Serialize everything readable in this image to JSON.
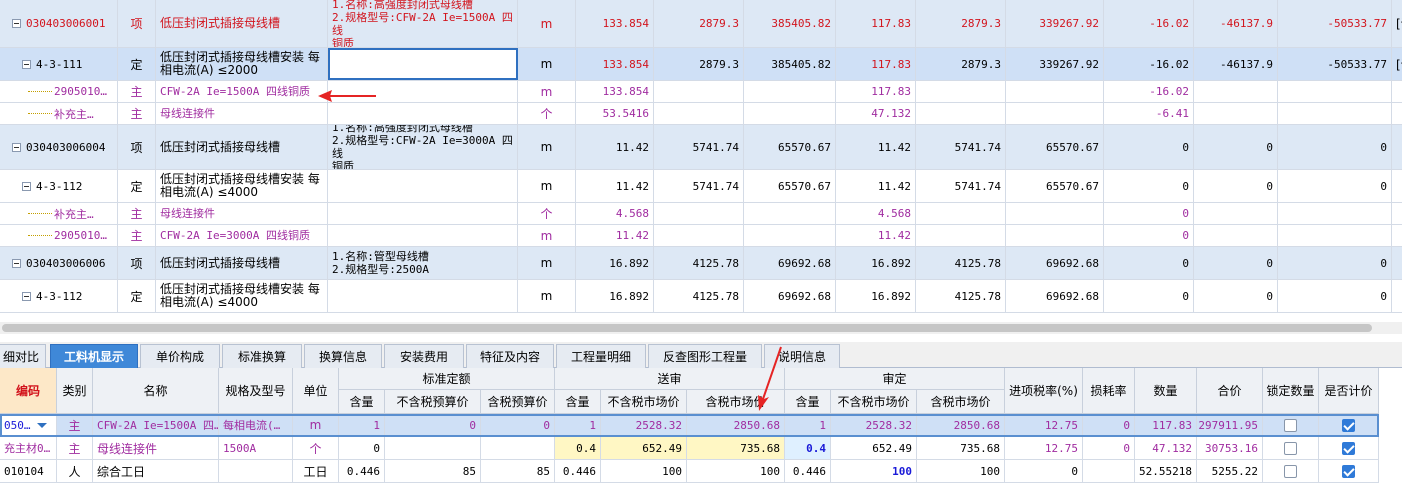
{
  "top_rows": [
    {
      "type": "qd",
      "code": "030403006001",
      "cat": "项",
      "name": "低压封闭式插接母线槽",
      "feat": [
        "1.名称:高强度封闭式母线槽",
        "2.规格型号:CFW-2A Ie=1500A 四线",
        "铜质"
      ],
      "unit": "m",
      "v": [
        "133.854",
        "2879.3",
        "385405.82",
        "117.83",
        "2879.3",
        "339267.92",
        "-16.02",
        "-46137.9",
        "-50533.77"
      ],
      "note": "[调量]",
      "color": "red"
    },
    {
      "type": "sel",
      "code": "4-3-111",
      "cat": "定",
      "name": "低压封闭式插接母线槽安装 每相电流(A) ≤2000",
      "feat": [],
      "unit": "m",
      "v": [
        "133.854",
        "2879.3",
        "385405.82",
        "117.83",
        "2879.3",
        "339267.92",
        "-16.02",
        "-46137.9",
        "-50533.77"
      ],
      "note": "[调量]",
      "color": "mix"
    },
    {
      "type": "zhu",
      "code": "2905010…",
      "cat": "主",
      "name": "CFW-2A Ie=1500A 四线铜质",
      "feat": [],
      "unit": "m",
      "v": [
        "133.854",
        "",
        "",
        "117.83",
        "",
        "",
        "-16.02",
        "",
        ""
      ],
      "note": "",
      "color": "pur"
    },
    {
      "type": "zhu",
      "code": "补充主…",
      "cat": "主",
      "name": "母线连接件",
      "feat": [],
      "unit": "个",
      "v": [
        "53.5416",
        "",
        "",
        "47.132",
        "",
        "",
        "-6.41",
        "",
        ""
      ],
      "note": "",
      "color": "pur"
    },
    {
      "type": "qd",
      "code": "030403006004",
      "cat": "项",
      "name": "低压封闭式插接母线槽",
      "feat": [
        "1.名称:高强度封闭式母线槽",
        "2.规格型号:CFW-2A Ie=3000A 四线",
        "铜质"
      ],
      "unit": "m",
      "v": [
        "11.42",
        "5741.74",
        "65570.67",
        "11.42",
        "5741.74",
        "65570.67",
        "0",
        "0",
        "0"
      ],
      "note": "",
      "color": "black"
    },
    {
      "type": "de",
      "code": "4-3-112",
      "cat": "定",
      "name": "低压封闭式插接母线槽安装 每相电流(A) ≤4000",
      "feat": [],
      "unit": "m",
      "v": [
        "11.42",
        "5741.74",
        "65570.67",
        "11.42",
        "5741.74",
        "65570.67",
        "0",
        "0",
        "0"
      ],
      "note": "",
      "color": "black"
    },
    {
      "type": "zhu",
      "code": "补充主…",
      "cat": "主",
      "name": "母线连接件",
      "feat": [],
      "unit": "个",
      "v": [
        "4.568",
        "",
        "",
        "4.568",
        "",
        "",
        "0",
        "",
        ""
      ],
      "note": "",
      "color": "pur"
    },
    {
      "type": "zhu",
      "code": "2905010…",
      "cat": "主",
      "name": "CFW-2A Ie=3000A 四线铜质",
      "feat": [],
      "unit": "m",
      "v": [
        "11.42",
        "",
        "",
        "11.42",
        "",
        "",
        "0",
        "",
        ""
      ],
      "note": "",
      "color": "pur"
    },
    {
      "type": "qd",
      "code": "030403006006",
      "cat": "项",
      "name": "低压封闭式插接母线槽",
      "feat": [
        "1.名称:管型母线槽",
        "2.规格型号:2500A"
      ],
      "unit": "m",
      "v": [
        "16.892",
        "4125.78",
        "69692.68",
        "16.892",
        "4125.78",
        "69692.68",
        "0",
        "0",
        "0"
      ],
      "note": "",
      "color": "black"
    },
    {
      "type": "de",
      "code": "4-3-112",
      "cat": "定",
      "name": "低压封闭式插接母线槽安装 每相电流(A) ≤4000",
      "feat": [],
      "unit": "m",
      "v": [
        "16.892",
        "4125.78",
        "69692.68",
        "16.892",
        "4125.78",
        "69692.68",
        "0",
        "0",
        "0"
      ],
      "note": "",
      "color": "black"
    }
  ],
  "tabs": [
    "细对比",
    "工料机显示",
    "单价构成",
    "标准换算",
    "换算信息",
    "安装费用",
    "特征及内容",
    "工程量明细",
    "反查图形工程量",
    "说明信息"
  ],
  "bottom_headers": {
    "code": "编码",
    "cat": "类别",
    "name": "名称",
    "spec": "规格及型号",
    "unit": "单位",
    "g_std": "标准定额",
    "g_send": "送审",
    "g_audit": "审定",
    "qty": "含量",
    "notax_budget": "不含税预算价",
    "tax_budget": "含税预算价",
    "notax_market": "不含税市场价",
    "tax_market": "含税市场价",
    "taxrate": "进项税率(%)",
    "loss": "损耗率",
    "count": "数量",
    "total": "合价",
    "lock": "锁定数量",
    "priced": "是否计价"
  },
  "bottom_rows": [
    {
      "code": "050…",
      "cat": "主",
      "name": "CFW-2A Ie=1500A 四…",
      "spec": "每相电流(…",
      "unit": "m",
      "v": [
        "1",
        "0",
        "0",
        "1",
        "2528.32",
        "2850.68",
        "1",
        "2528.32",
        "2850.68",
        "12.75",
        "0",
        "117.83",
        "297911.95"
      ],
      "lock": false,
      "priced": true,
      "sel": true
    },
    {
      "code": "充主材0…",
      "cat": "主",
      "name": "母线连接件",
      "spec": "1500A",
      "unit": "个",
      "v": [
        "0",
        "",
        "",
        "0.4",
        "652.49",
        "735.68",
        "0.4",
        "652.49",
        "735.68",
        "12.75",
        "0",
        "47.132",
        "30753.16"
      ],
      "lock": false,
      "priced": true,
      "sel": false
    },
    {
      "code": "010104",
      "cat": "人",
      "name": "综合工日",
      "spec": "",
      "unit": "工日",
      "v": [
        "0.446",
        "85",
        "85",
        "0.446",
        "100",
        "100",
        "0.446",
        "100",
        "100",
        "0",
        "",
        "52.55218",
        "5255.22"
      ],
      "lock": false,
      "priced": true,
      "sel": false
    }
  ]
}
